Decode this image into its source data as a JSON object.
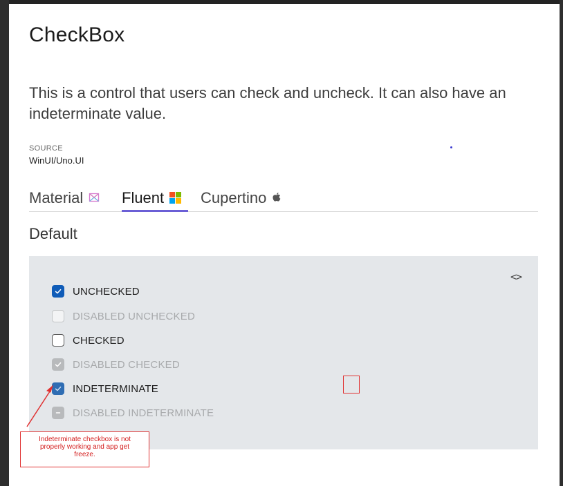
{
  "page": {
    "title": "CheckBox",
    "description": "This is a control that users can check and uncheck. It can also have an indeterminate value.",
    "source_label": "SOURCE",
    "source_value": "WinUI/Uno.UI"
  },
  "tabs": [
    {
      "label": "Material",
      "icon": "material-icon",
      "selected": false
    },
    {
      "label": "Fluent",
      "icon": "windows-logo-icon",
      "selected": true
    },
    {
      "label": "Cupertino",
      "icon": "apple-icon",
      "selected": false
    }
  ],
  "section": {
    "title": "Default",
    "code_toggle": "<>"
  },
  "checkboxes": [
    {
      "label": "UNCHECKED",
      "state": "checked",
      "enabled": true
    },
    {
      "label": "DISABLED UNCHECKED",
      "state": "unchecked",
      "enabled": false
    },
    {
      "label": "CHECKED",
      "state": "unchecked",
      "enabled": true
    },
    {
      "label": "DISABLED CHECKED",
      "state": "checked",
      "enabled": false
    },
    {
      "label": "INDETERMINATE",
      "state": "checked",
      "enabled": true
    },
    {
      "label": "DISABLED INDETERMINATE",
      "state": "indeterminate",
      "enabled": false
    }
  ],
  "annotation": {
    "lines": [
      "Indeterminate checkbox is not",
      "properly working and app get",
      "freeze."
    ],
    "color": "#e03030"
  },
  "colors": {
    "accent": "#0f5cb8",
    "tab_indicator": "#6b5fd6",
    "panel_background": "#e4e7ea"
  }
}
